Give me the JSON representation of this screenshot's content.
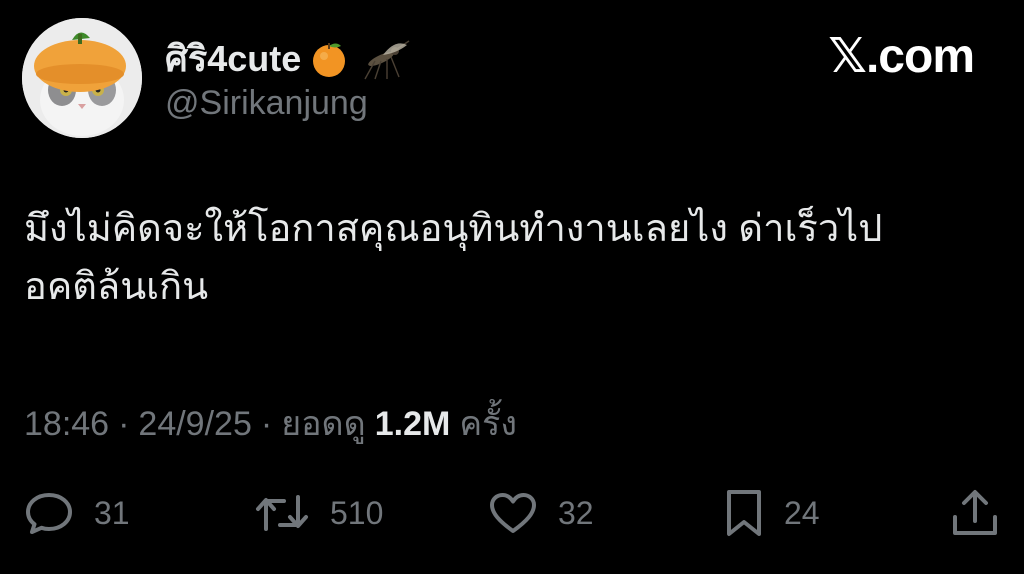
{
  "user": {
    "display_name": "ศิริ4cute",
    "handle": "@Sirikanjung",
    "name_emojis": [
      "orange-emoji",
      "mosquito-emoji"
    ]
  },
  "brand": "𝕏.com",
  "tweet": {
    "lines": [
      "มึงไม่คิดจะให้โอกาสคุณอนุทินทำงานเลยไง ด่าเร็วไป",
      "อคติล้นเกิน"
    ]
  },
  "meta": {
    "time": "18:46",
    "separator1": "·",
    "date": "24/9/25",
    "separator2": "·",
    "views_label": "ยอดดู",
    "views_count": "1.2M",
    "views_unit": "ครั้ง"
  },
  "actions": {
    "replies": "31",
    "reposts": "510",
    "likes": "32",
    "bookmarks": "24"
  },
  "colors": {
    "background": "#000000",
    "text": "#e7e9ea",
    "secondary": "#71767b"
  }
}
